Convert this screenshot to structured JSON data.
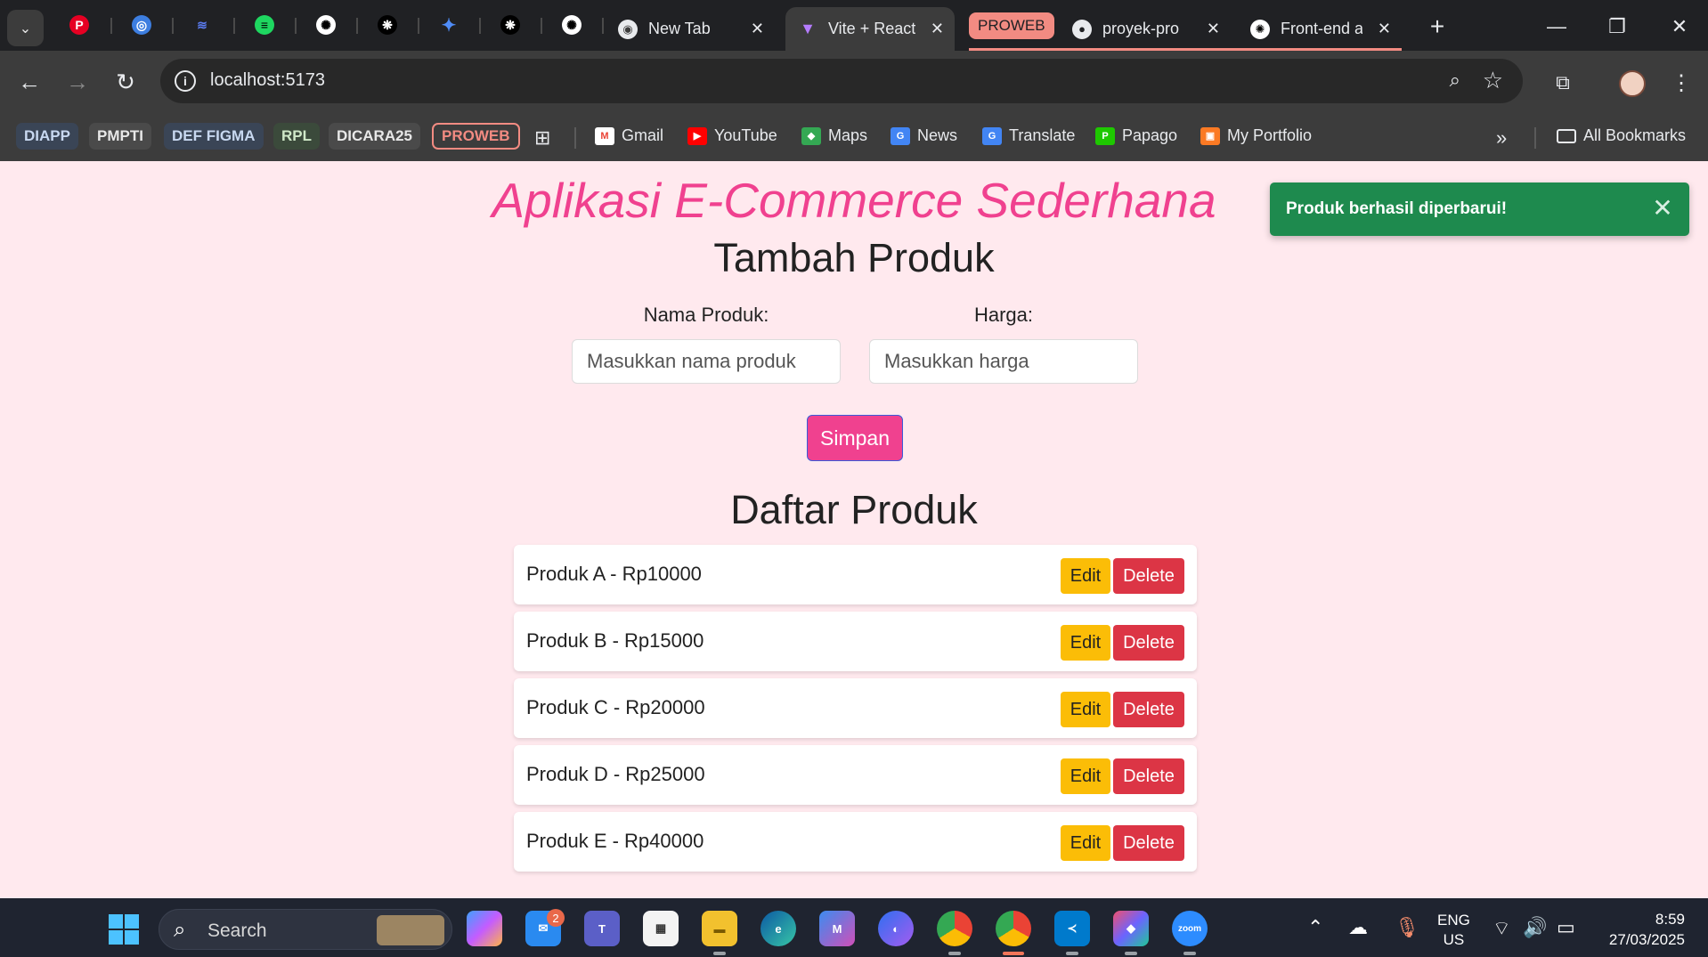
{
  "browser": {
    "tabs": [
      {
        "label": "New Tab"
      },
      {
        "label": "Vite + React"
      },
      {
        "label": "proyek-pro"
      },
      {
        "label": "Front-end a"
      }
    ],
    "tab_group": "PROWEB",
    "new_tab_symbol": "+",
    "url": "localhost:5173"
  },
  "bookmarks": {
    "chips": [
      "DIAPP",
      "PMPTI",
      "DEF FIGMA",
      "RPL",
      "DICARA25",
      "PROWEB"
    ],
    "links": [
      "Gmail",
      "YouTube",
      "Maps",
      "News",
      "Translate",
      "Papago",
      "My Portfolio"
    ],
    "all_label": "All Bookmarks"
  },
  "app": {
    "title": "Aplikasi E-Commerce Sederhana",
    "form_title": "Tambah Produk",
    "name_label": "Nama Produk:",
    "name_placeholder": "Masukkan nama produk",
    "price_label": "Harga:",
    "price_placeholder": "Masukkan harga",
    "save_label": "Simpan",
    "list_title": "Daftar Produk",
    "edit_label": "Edit",
    "delete_label": "Delete",
    "products": [
      {
        "text": "Produk A - Rp10000"
      },
      {
        "text": "Produk B - Rp15000"
      },
      {
        "text": "Produk C - Rp20000"
      },
      {
        "text": "Produk D - Rp25000"
      },
      {
        "text": "Produk E - Rp40000"
      }
    ]
  },
  "toast": {
    "message": "Produk berhasil diperbarui!"
  },
  "taskbar": {
    "search_label": "Search",
    "mail_badge": "2",
    "lang_line1": "ENG",
    "lang_line2": "US",
    "time": "8:59",
    "date": "27/03/2025"
  },
  "colors": {
    "page_bg": "#ffe9ee",
    "accent_pink": "#f0418f",
    "edit_yellow": "#fbbd07",
    "delete_red": "#dc3545",
    "toast_green": "#1e8a4e"
  }
}
